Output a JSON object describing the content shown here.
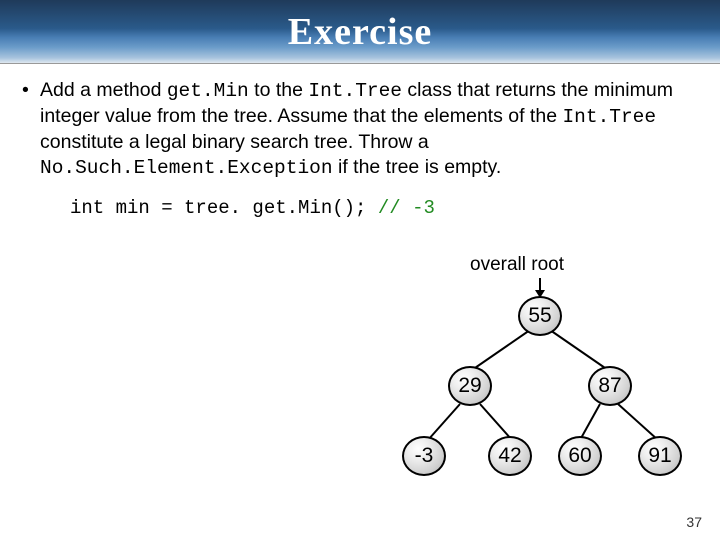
{
  "title": "Exercise",
  "bullet": {
    "dot": "•",
    "t1": "Add a method ",
    "c1": "get.Min",
    "t2": " to the ",
    "c2": "Int.Tree",
    "t3": " class that returns the minimum integer value from the tree.  Assume that the elements of the ",
    "c3": "Int.Tree",
    "t4": " constitute a legal binary search tree. Throw a ",
    "c4": "No.Such.Element.Exception",
    "t5": " if the tree is empty."
  },
  "codeLine": {
    "code": "int min = tree. get.Min();  ",
    "comment": "// -3"
  },
  "rootLabel": "overall root",
  "tree": {
    "n55": "55",
    "n29": "29",
    "n87": "87",
    "nm3": "-3",
    "n42": "42",
    "n60": "60",
    "n91": "91"
  },
  "pageNumber": "37"
}
